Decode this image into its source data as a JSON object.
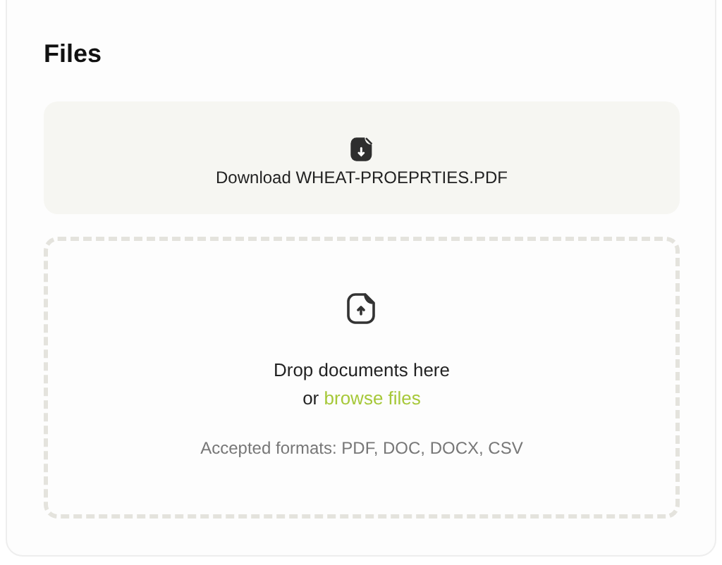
{
  "card": {
    "title": "Files"
  },
  "download": {
    "label": "Download WHEAT-PROEPRTIES.PDF"
  },
  "dropzone": {
    "heading": "Drop documents here",
    "prompt_prefix": "or",
    "link": "browse files",
    "formats": "Accepted formats: PDF, DOC, DOCX, CSV"
  }
}
